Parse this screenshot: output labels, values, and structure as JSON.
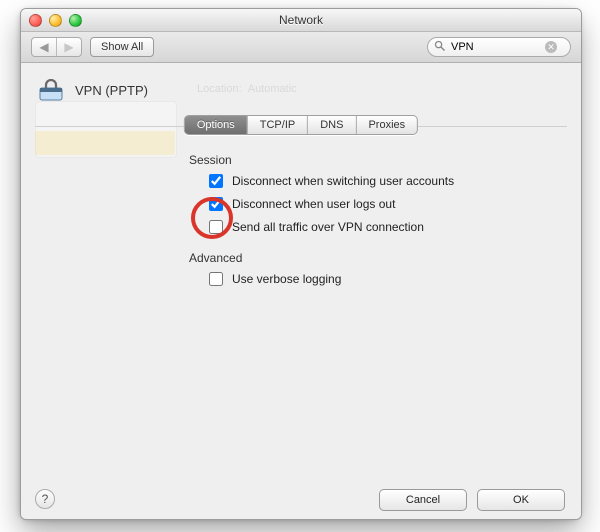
{
  "window": {
    "title": "Network"
  },
  "toolbar": {
    "show_all_label": "Show All",
    "search_value": "VPN"
  },
  "header": {
    "name": "VPN (PPTP)"
  },
  "tabs": [
    {
      "label": "Options",
      "selected": true
    },
    {
      "label": "TCP/IP",
      "selected": false
    },
    {
      "label": "DNS",
      "selected": false
    },
    {
      "label": "Proxies",
      "selected": false
    }
  ],
  "session": {
    "title": "Session",
    "items": [
      {
        "label": "Disconnect when switching user accounts",
        "checked": true
      },
      {
        "label": "Disconnect when user logs out",
        "checked": true
      },
      {
        "label": "Send all traffic over VPN connection",
        "checked": false
      }
    ]
  },
  "advanced": {
    "title": "Advanced",
    "items": [
      {
        "label": "Use verbose logging",
        "checked": false
      }
    ]
  },
  "buttons": {
    "cancel": "Cancel",
    "ok": "OK",
    "help": "?"
  }
}
